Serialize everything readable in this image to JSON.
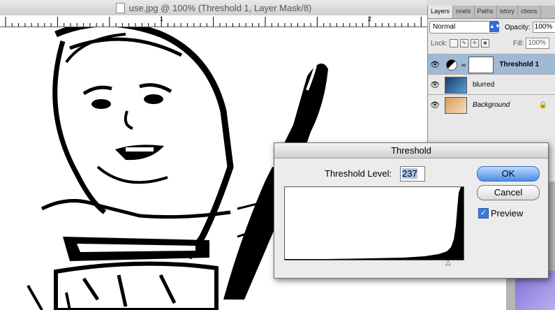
{
  "document": {
    "title": "use.jpg @ 100% (Threshold 1, Layer Mask/8)",
    "ruler_labels": [
      "1",
      "2"
    ]
  },
  "layers_panel": {
    "tabs": [
      "Layers",
      "nnels",
      "Paths",
      "istory",
      "ctions"
    ],
    "blend_mode": "Normal",
    "opacity_label": "Opacity:",
    "opacity_value": "100%",
    "lock_label": "Lock:",
    "fill_label": "Fill:",
    "fill_value": "100%",
    "layers": [
      {
        "name": "Threshold 1",
        "selected": true
      },
      {
        "name": "blurred",
        "selected": false
      },
      {
        "name": "Background",
        "selected": false
      }
    ]
  },
  "threshold_dialog": {
    "title": "Threshold",
    "level_label": "Threshold Level:",
    "level_value": "237",
    "ok_label": "OK",
    "cancel_label": "Cancel",
    "preview_label": "Preview",
    "preview_checked": true
  }
}
